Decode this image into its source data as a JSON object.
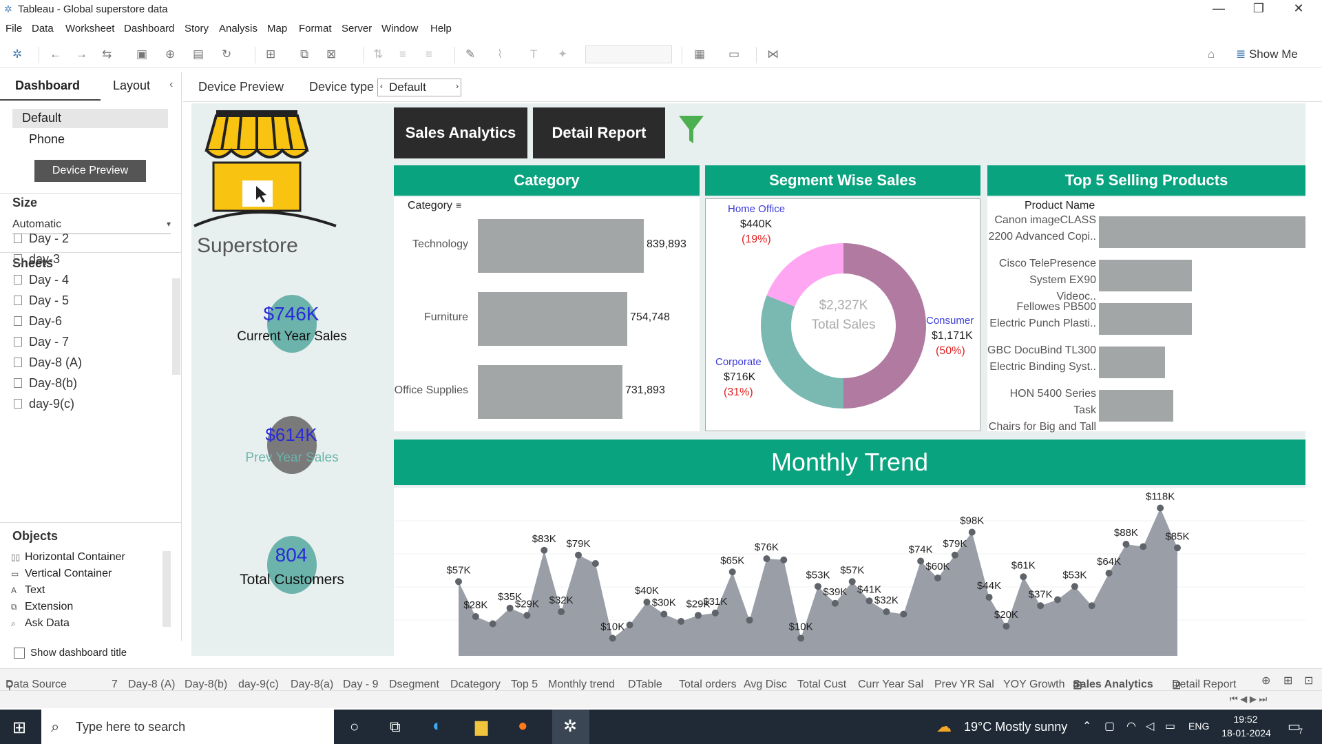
{
  "window": {
    "title": "Tableau - Global superstore data"
  },
  "menu": [
    "File",
    "Data",
    "Worksheet",
    "Dashboard",
    "Story",
    "Analysis",
    "Map",
    "Format",
    "Server",
    "Window",
    "Help"
  ],
  "toolbar": {
    "show_me": "Show Me"
  },
  "left_pane": {
    "tabs": [
      "Dashboard",
      "Layout"
    ],
    "devices": [
      "Default",
      "Phone"
    ],
    "device_preview_button": "Device Preview",
    "size_heading": "Size",
    "size_value": "Automatic",
    "sheets_heading": "Sheets",
    "sheets": [
      "Day - 2",
      "day-3",
      "Day - 4",
      "Day - 5",
      "Day-6",
      "Day - 7",
      "Day-8 (A)",
      "Day-8(b)",
      "day-9(c)"
    ],
    "objects_heading": "Objects",
    "objects": [
      "Horizontal Container",
      "Vertical Container",
      "Text",
      "Extension",
      "Ask Data"
    ],
    "show_title_label": "Show dashboard title"
  },
  "dashbar": {
    "device_preview": "Device Preview",
    "device_type_label": "Device type",
    "device_type_value": "Default"
  },
  "dashboard": {
    "brand": "Superstore",
    "nav_buttons": [
      "Sales Analytics",
      "Detail Report"
    ],
    "kpis": [
      {
        "value": "$746K",
        "label": "Current Year Sales",
        "circle_color": "#6bb3ab"
      },
      {
        "value": "$614K",
        "label": "Prev Year Sales",
        "circle_color": "#7a7a7a"
      },
      {
        "value": "804",
        "label": "Total Customers",
        "circle_color": "#6bb3ab"
      }
    ],
    "category": {
      "header": "Category",
      "field_label": "Category",
      "items": [
        {
          "name": "Technology",
          "value": 839893,
          "label": "839,893"
        },
        {
          "name": "Furniture",
          "value": 754748,
          "label": "754,748"
        },
        {
          "name": "Office Supplies",
          "value": 731893,
          "label": "731,893"
        }
      ]
    },
    "segment": {
      "header": "Segment Wise Sales",
      "center_value": "$2,327K",
      "center_label": "Total Sales",
      "slices": [
        {
          "name": "Consumer",
          "value": "$1,171K",
          "pct": "(50%)",
          "share": 0.5,
          "color": "#b07aa1"
        },
        {
          "name": "Corporate",
          "value": "$716K",
          "pct": "(31%)",
          "share": 0.31,
          "color": "#7ab8b2"
        },
        {
          "name": "Home Office",
          "value": "$440K",
          "pct": "(19%)",
          "share": 0.19,
          "color": "#ffa6f2"
        }
      ]
    },
    "top5": {
      "header": "Top 5 Selling Products",
      "column_label": "Product Name",
      "items": [
        {
          "l1": "Canon imageCLASS",
          "l2": "2200 Advanced Copi..",
          "share": 1.0
        },
        {
          "l1": "Cisco TelePresence",
          "l2": "System EX90 Videoc..",
          "share": 0.45
        },
        {
          "l1": "Fellowes PB500",
          "l2": "Electric Punch Plasti..",
          "share": 0.45
        },
        {
          "l1": "GBC DocuBind TL300",
          "l2": "Electric Binding Syst..",
          "share": 0.32
        },
        {
          "l1": "HON 5400 Series Task",
          "l2": "Chairs for Big and Tall",
          "share": 0.36
        }
      ]
    },
    "monthly": {
      "header": "Monthly Trend"
    }
  },
  "chart_data": {
    "type": "area",
    "title": "Monthly Trend",
    "unit": "$K",
    "points": [
      {
        "v": 57,
        "label": "$57K"
      },
      {
        "v": 28,
        "label": "$28K"
      },
      {
        "v": 22,
        "label": ""
      },
      {
        "v": 35,
        "label": "$35K"
      },
      {
        "v": 29,
        "label": "$29K"
      },
      {
        "v": 83,
        "label": "$83K"
      },
      {
        "v": 32,
        "label": "$32K"
      },
      {
        "v": 79,
        "label": "$79K"
      },
      {
        "v": 72,
        "label": ""
      },
      {
        "v": 10,
        "label": "$10K"
      },
      {
        "v": 21,
        "label": ""
      },
      {
        "v": 40,
        "label": "$40K"
      },
      {
        "v": 30,
        "label": "$30K"
      },
      {
        "v": 24,
        "label": ""
      },
      {
        "v": 29,
        "label": "$29K"
      },
      {
        "v": 31,
        "label": "$31K"
      },
      {
        "v": 65,
        "label": "$65K"
      },
      {
        "v": 25,
        "label": ""
      },
      {
        "v": 76,
        "label": "$76K"
      },
      {
        "v": 75,
        "label": ""
      },
      {
        "v": 10,
        "label": "$10K"
      },
      {
        "v": 53,
        "label": "$53K"
      },
      {
        "v": 39,
        "label": "$39K"
      },
      {
        "v": 57,
        "label": "$57K"
      },
      {
        "v": 41,
        "label": "$41K"
      },
      {
        "v": 32,
        "label": "$32K"
      },
      {
        "v": 30,
        "label": ""
      },
      {
        "v": 74,
        "label": "$74K"
      },
      {
        "v": 60,
        "label": "$60K"
      },
      {
        "v": 79,
        "label": "$79K"
      },
      {
        "v": 98,
        "label": "$98K"
      },
      {
        "v": 44,
        "label": "$44K"
      },
      {
        "v": 20,
        "label": "$20K"
      },
      {
        "v": 61,
        "label": "$61K"
      },
      {
        "v": 37,
        "label": "$37K"
      },
      {
        "v": 42,
        "label": ""
      },
      {
        "v": 53,
        "label": "$53K"
      },
      {
        "v": 37,
        "label": ""
      },
      {
        "v": 64,
        "label": "$64K"
      },
      {
        "v": 88,
        "label": "$88K"
      },
      {
        "v": 86,
        "label": ""
      },
      {
        "v": 118,
        "label": "$118K"
      },
      {
        "v": 85,
        "label": "$85K"
      }
    ]
  },
  "sheet_tabs": [
    "Data Source",
    "7",
    "Day-8 (A)",
    "Day-8(b)",
    "day-9(c)",
    "Day-8(a)",
    "Day - 9",
    "Dsegment",
    "Dcategory",
    "Top 5",
    "Monthly trend",
    "DTable",
    "Total orders",
    "Avg Disc",
    "Total Cust",
    "Curr Year Sal",
    "Prev YR Sal",
    "YOY Growth",
    "Sales Analytics",
    "Detail Report"
  ],
  "active_sheet_tab": "Sales Analytics",
  "taskbar": {
    "search_placeholder": "Type here to search",
    "weather": "19°C  Mostly sunny",
    "lang": "ENG",
    "time": "19:52",
    "date": "18-01-2024",
    "notification_count": "7"
  }
}
